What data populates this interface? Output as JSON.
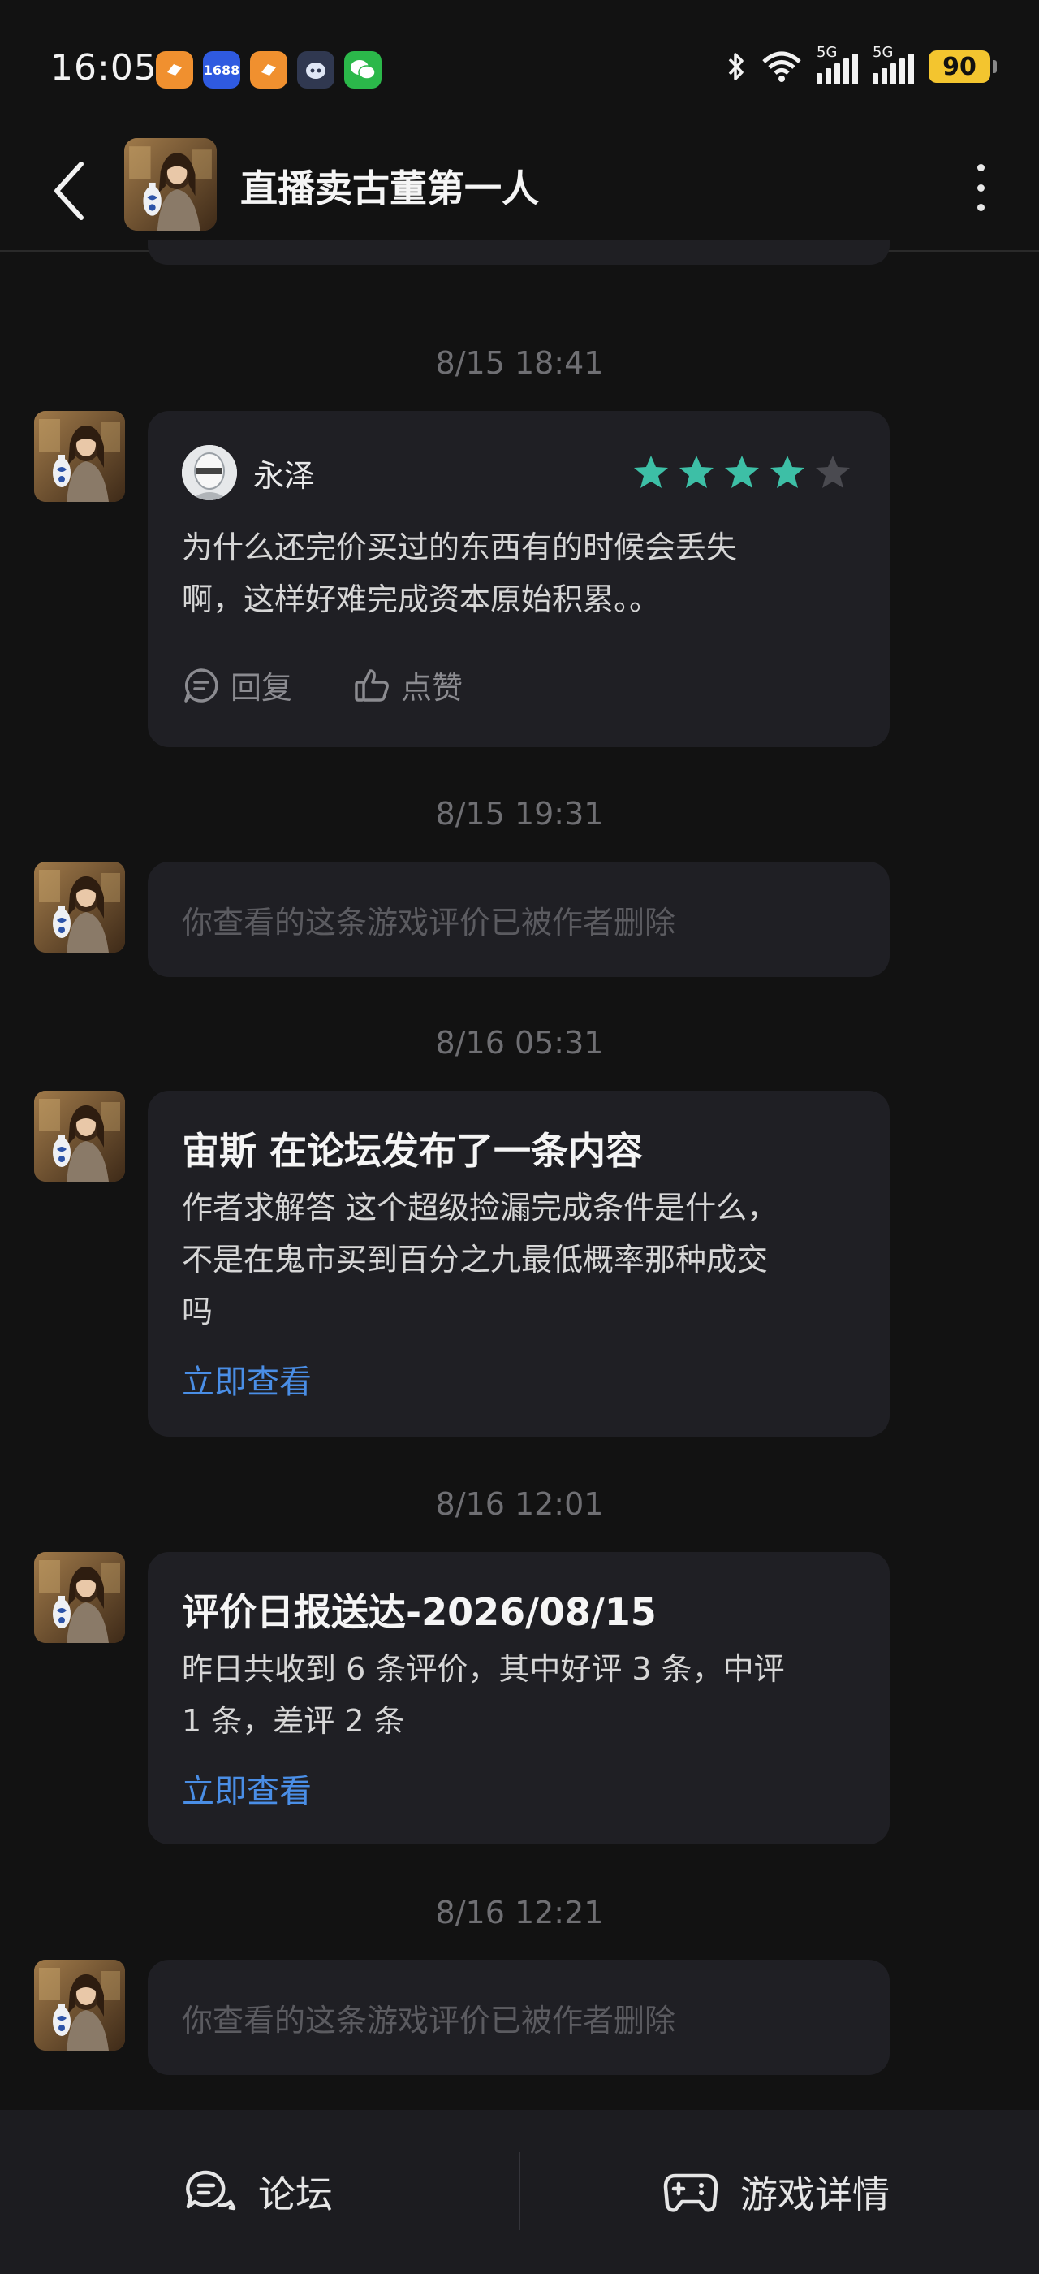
{
  "status_bar": {
    "time": "16:05",
    "apps": [
      {
        "icon": "app-orange-icon",
        "color": "#f0902f",
        "label": ""
      },
      {
        "icon": "app-1688-icon",
        "color": "#2f5ae0",
        "label": "1688"
      },
      {
        "icon": "app-orange2-icon",
        "color": "#f0902f",
        "label": ""
      },
      {
        "icon": "app-robot-icon",
        "color": "#303850",
        "label": ""
      },
      {
        "icon": "wechat-icon",
        "color": "#2bb84a",
        "label": ""
      }
    ],
    "signal1_label": "5G",
    "signal2_label": "5G",
    "battery": "90"
  },
  "header": {
    "title": "直播卖古董第一人"
  },
  "messages": [
    {
      "timestamp": "8/15  18:41",
      "type": "review",
      "user": "永泽",
      "rating": 4,
      "max_rating": 5,
      "text_lines": [
        "为什么还完价买过的东西有的时候会丢失",
        "啊，这样好难完成资本原始积累。。"
      ],
      "reply_label": "回复",
      "like_label": "点赞"
    },
    {
      "timestamp": "8/15  19:31",
      "type": "deleted",
      "text": "你查看的这条游戏评价已被作者删除"
    },
    {
      "timestamp": "8/16  05:31",
      "type": "forum",
      "title": "宙斯 在论坛发布了一条内容",
      "text_lines": [
        "作者求解答 这个超级捡漏完成条件是什么，",
        "不是在鬼市买到百分之九最低概率那种成交",
        "吗"
      ],
      "link": "立即查看"
    },
    {
      "timestamp": "8/16  12:01",
      "type": "report",
      "title": "评价日报送达-2026/08/15",
      "text_lines": [
        "昨日共收到 6 条评价，其中好评 3 条，中评",
        "1 条，差评 2 条"
      ],
      "link": "立即查看"
    },
    {
      "timestamp": "8/16  12:21",
      "type": "deleted",
      "text": "你查看的这条游戏评价已被作者删除"
    }
  ],
  "bottom_bar": {
    "forum_label": "论坛",
    "details_label": "游戏详情"
  },
  "colors": {
    "background": "#121212",
    "card": "#1f1f24",
    "link": "#4a8ee6",
    "star_filled": "#3dbfa6",
    "star_empty": "#4a4a50"
  }
}
